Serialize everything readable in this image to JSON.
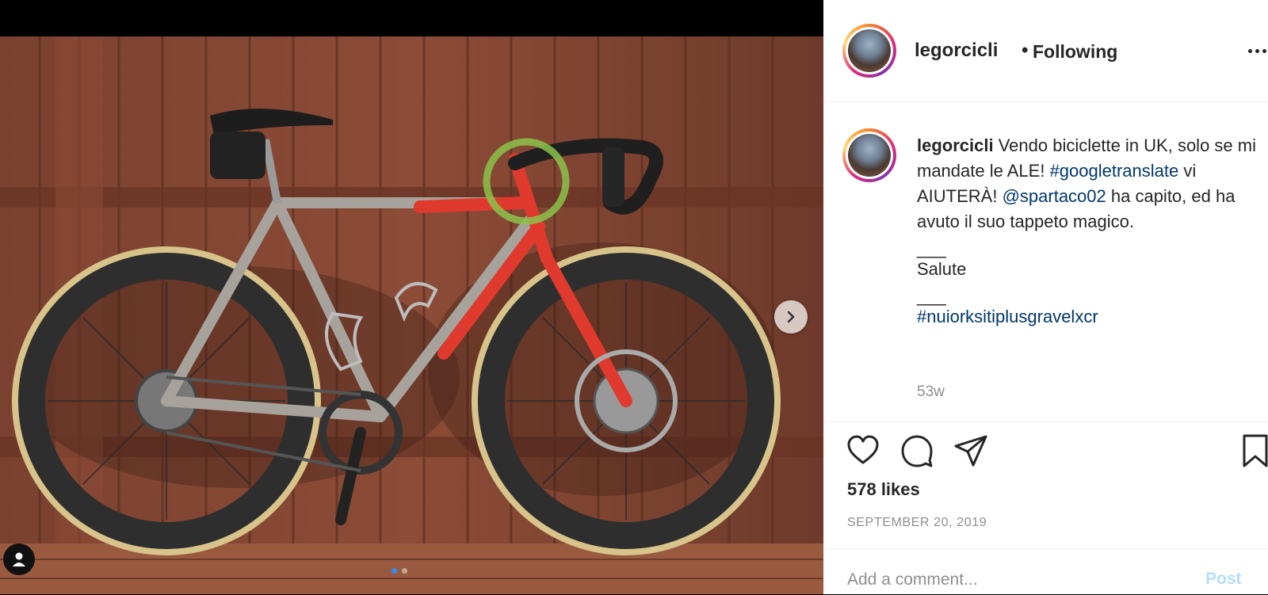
{
  "post": {
    "username": "legorcicli",
    "follow_separator": "•",
    "follow_status": "Following",
    "caption": {
      "username": "legorcicli",
      "segments": [
        {
          "type": "text",
          "value": " Vendo biciclette in UK, solo se mi mandate le ALE! "
        },
        {
          "type": "hashtag",
          "value": "#googletranslate"
        },
        {
          "type": "text",
          "value": " vi AIUTERÀ! "
        },
        {
          "type": "mention",
          "value": "@spartaco02"
        },
        {
          "type": "text",
          "value": " ha capito, ed ha avuto il suo tappeto magico."
        }
      ],
      "divider_1": "___",
      "salute": "Salute",
      "divider_2": "___",
      "final_hashtag": "#nuiorksitiplusgravelxcr"
    },
    "time_ago": "53w",
    "likes": "578 likes",
    "date": "SEPTEMBER 20, 2019",
    "comment_placeholder": "Add a comment...",
    "post_button": "Post",
    "carousel": {
      "current": 1,
      "total": 2
    }
  },
  "icons": {
    "like": "heart-icon",
    "comment": "comment-icon",
    "share": "paper-plane-icon",
    "save": "bookmark-icon",
    "more": "more-dots-icon",
    "next": "chevron-right-icon",
    "tag": "user-tag-icon"
  },
  "colors": {
    "link": "#00376b",
    "muted": "#8e8e8e",
    "text": "#262626",
    "frame_red": "#e03a2e",
    "annotation_circle": "#8bc34a"
  }
}
